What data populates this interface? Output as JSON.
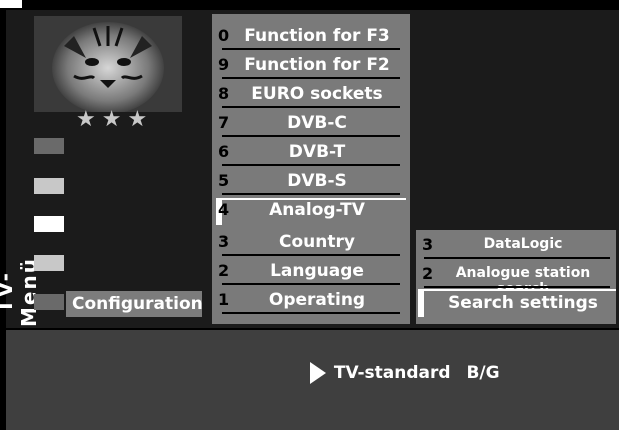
{
  "side_title": "TV-Menü",
  "stars": "★★★",
  "breadcrumb": "Configuration",
  "menu": [
    {
      "num": "0",
      "label": "Function for F3"
    },
    {
      "num": "9",
      "label": "Function for F2"
    },
    {
      "num": "8",
      "label": "EURO sockets"
    },
    {
      "num": "7",
      "label": "DVB-C"
    },
    {
      "num": "6",
      "label": "DVB-T"
    },
    {
      "num": "5",
      "label": "DVB-S"
    },
    {
      "num": "4",
      "label": "Analog-TV"
    },
    {
      "num": "3",
      "label": "Country"
    },
    {
      "num": "2",
      "label": "Language"
    },
    {
      "num": "1",
      "label": "Operating"
    }
  ],
  "submenu": [
    {
      "num": "3",
      "label": "DataLogic"
    },
    {
      "num": "2",
      "label": "Analogue station  search"
    },
    {
      "num": "",
      "label": "Search settings"
    }
  ],
  "status": {
    "label": "TV-standard",
    "value": "B/G"
  },
  "colors": {
    "menu_grey": "#7a7a7a",
    "background": "#1b1b1b",
    "highlight": "#ffffff"
  }
}
